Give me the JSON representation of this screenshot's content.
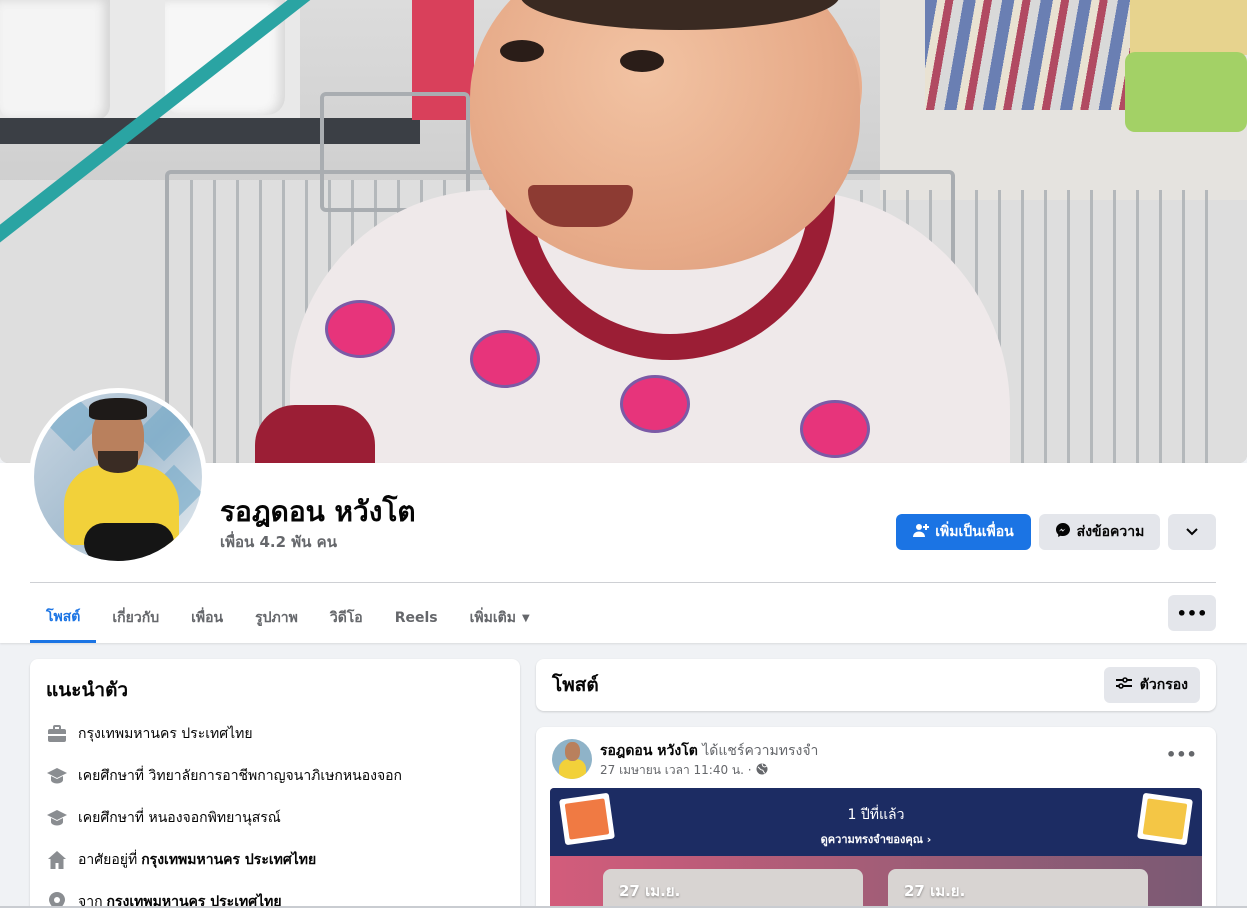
{
  "profile": {
    "name": "รอฎดอน หวังโต",
    "friends": "เพื่อน 4.2 พัน คน"
  },
  "actions": {
    "add_friend": "เพิ่มเป็นเพื่อน",
    "message": "ส่งข้อความ"
  },
  "tabs": [
    {
      "label": "โพสต์"
    },
    {
      "label": "เกี่ยวกับ"
    },
    {
      "label": "เพื่อน"
    },
    {
      "label": "รูปภาพ"
    },
    {
      "label": "วิดีโอ"
    },
    {
      "label": "Reels"
    },
    {
      "label": "เพิ่มเติม"
    }
  ],
  "intro": {
    "title": "แนะนำตัว",
    "items": [
      {
        "icon": "briefcase-icon",
        "text": "กรุงเทพมหานคร ประเทศไทย",
        "bold": ""
      },
      {
        "icon": "graduation-cap-icon",
        "text": "เคยศึกษาที่ วิทยาลัยการอาชีพกาญจนาภิเษกหนองจอก",
        "bold": ""
      },
      {
        "icon": "graduation-cap-icon",
        "text": "เคยศึกษาที่ หนองจอกพิทยานุสรณ์",
        "bold": ""
      },
      {
        "icon": "home-icon",
        "text": "อาศัยอยู่ที่",
        "bold": "กรุงเทพมหานคร ประเทศไทย"
      },
      {
        "icon": "location-pin-icon",
        "text": "จาก",
        "bold": "กรุงเทพมหานคร ประเทศไทย"
      }
    ]
  },
  "posts": {
    "title": "โพสต์",
    "filter_label": "ตัวกรอง"
  },
  "post": {
    "author": "รอฎดอน หวังโต",
    "action": "ได้แชร์ความทรงจำ",
    "timestamp": "27 เมษายน เวลา 11:40 น. ·",
    "memory": {
      "title": "1 ปีที่แล้ว",
      "link": "ดูความทรงจำของคุณ ›",
      "cards": [
        "27 เม.ย.",
        "27 เม.ย."
      ]
    }
  },
  "colors": {
    "accent": "#1b74e4",
    "button_gray": "#e4e6eb",
    "memory_header": "#1c2c63"
  }
}
